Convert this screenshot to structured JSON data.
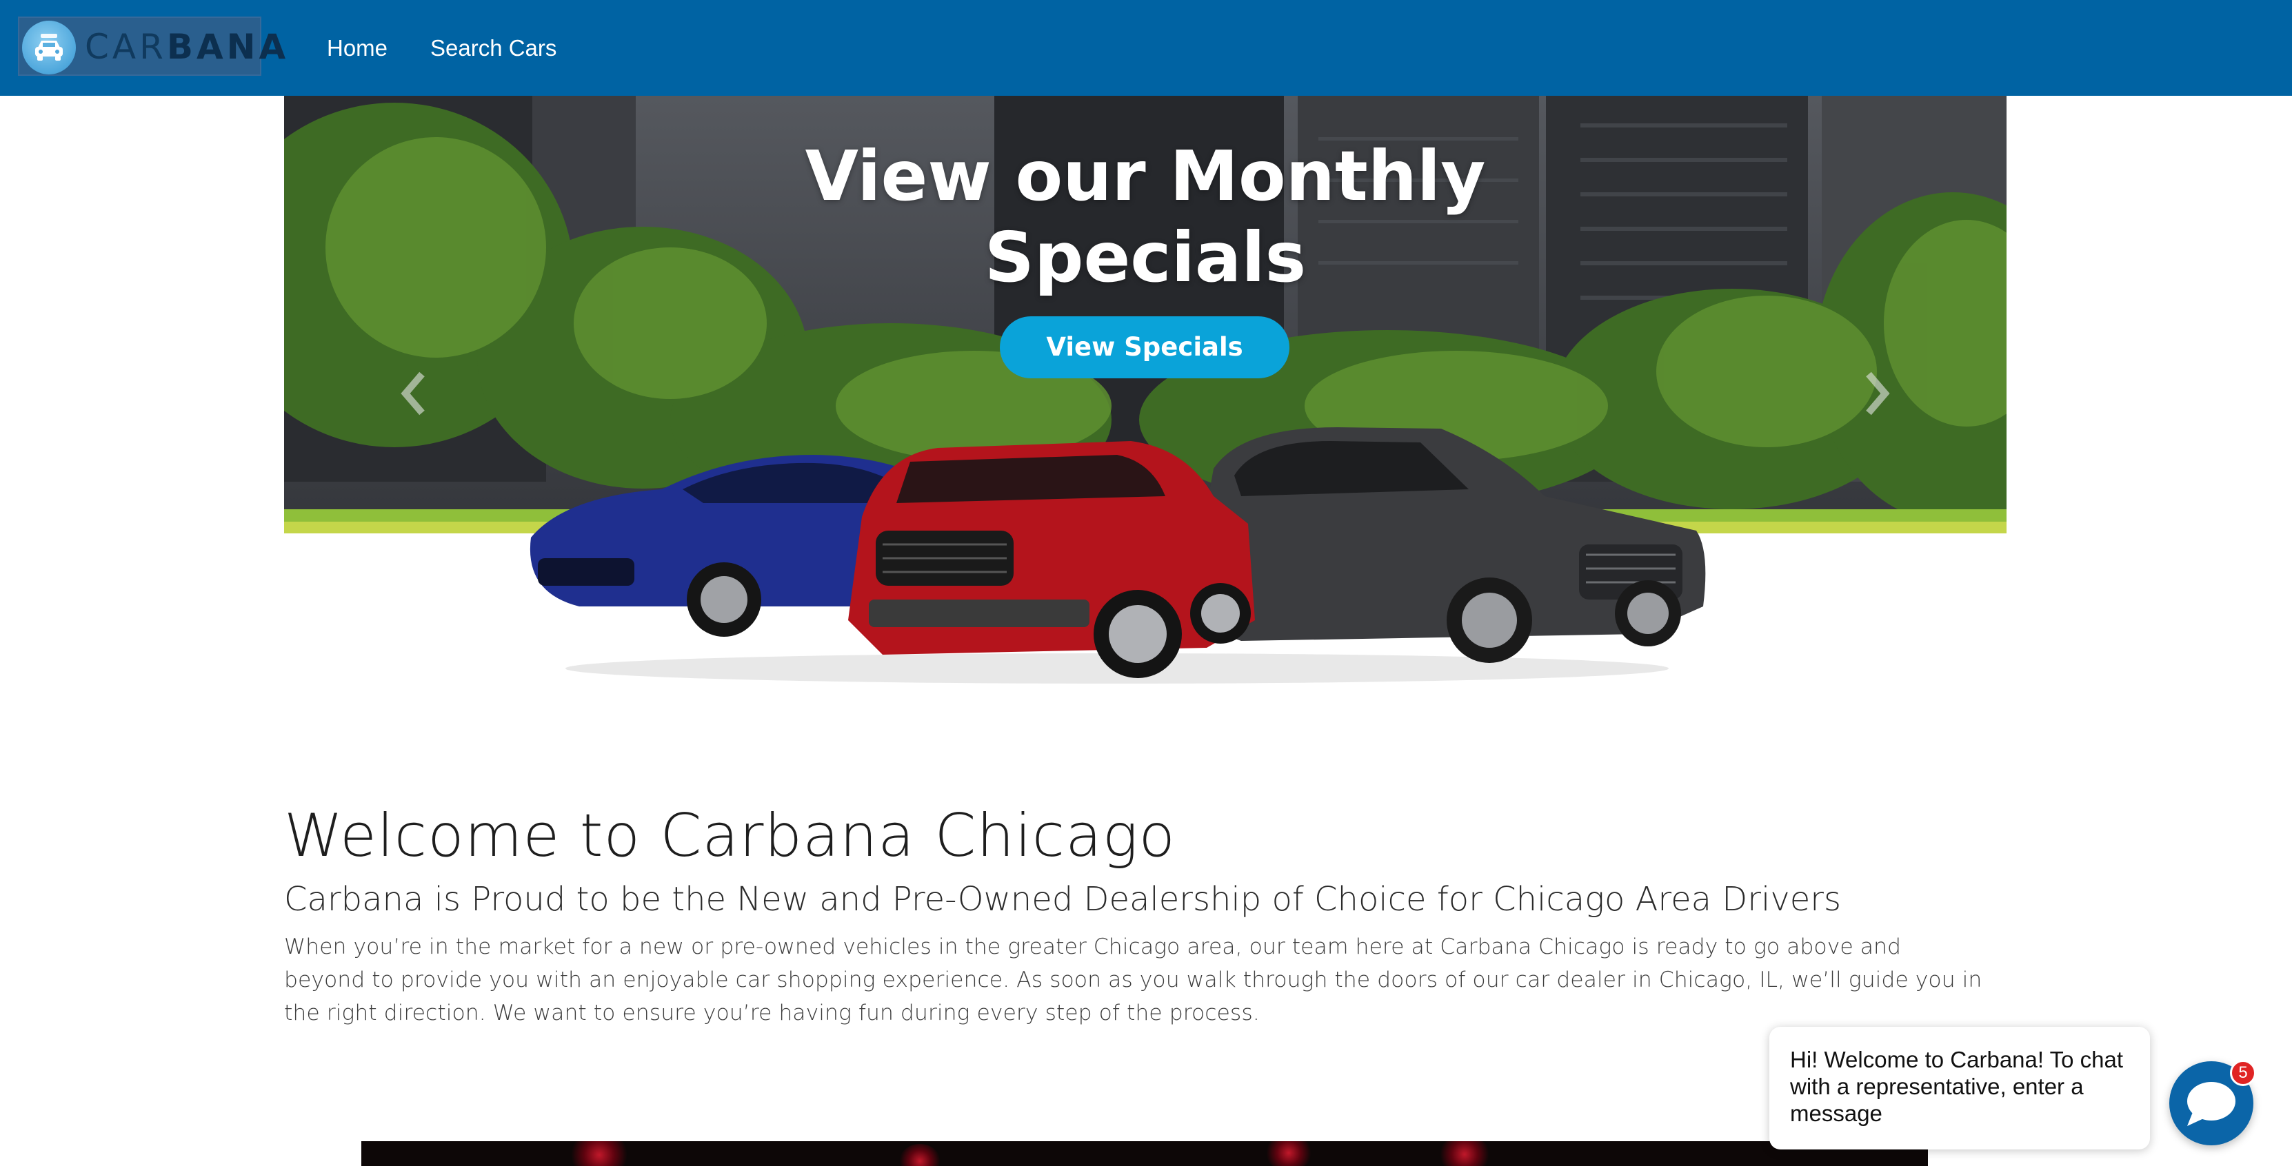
{
  "brand": {
    "logo_text_light": "CAR",
    "logo_text_bold": "BANA",
    "logo_icon": "car-icon",
    "nav_color": "#0063a3"
  },
  "nav": {
    "items": [
      {
        "label": "Home"
      },
      {
        "label": "Search Cars"
      }
    ]
  },
  "hero": {
    "title_line1": "View our Monthly",
    "title_line2": "Specials",
    "cta_label": "View Specials",
    "cta_color": "#0aa3d9",
    "prev_icon": "chevron-left-icon",
    "next_icon": "chevron-right-icon"
  },
  "welcome": {
    "title": "Welcome to Carbana Chicago",
    "subtitle": "Carbana is Proud to be the New and Pre-Owned Dealership of Choice for Chicago Area Drivers",
    "body": "When you’re in the market for a new or pre-owned vehicles in the greater Chicago area, our team here at Carbana Chicago is ready to go above and beyond to provide you with an enjoyable car shopping experience. As soon as you walk through the doors of our car dealer in Chicago, IL, we’ll guide you in the right direction. We want to ensure you’re having fun during every step of the process."
  },
  "chat": {
    "message": "Hi! Welcome to Carbana! To chat with a representative, enter a message",
    "badge_count": "5",
    "icon": "chat-bubble-icon",
    "button_color": "#0b65a8"
  }
}
